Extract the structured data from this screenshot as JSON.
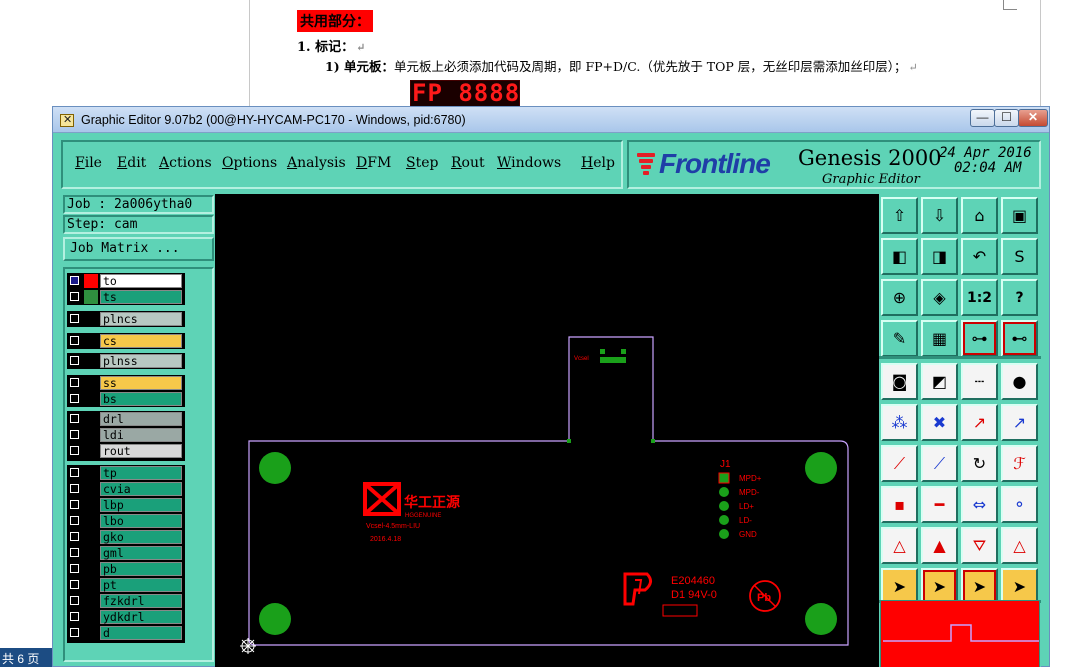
{
  "document": {
    "heading": "共用部分：",
    "section": "1.   标记：",
    "item_label": "1)   单元板：",
    "item_text": "单元板上必须添加代码及周期，即 FP+D/C.（优先放于 TOP 层，无丝印层需添加丝印层）；",
    "fp_sample": "FP 8888",
    "paragraph_mark": "↵",
    "status_page": "共 6 页"
  },
  "window": {
    "title": "Graphic Editor 9.07b2 (00@HY-HYCAM-PC170 - Windows, pid:6780)",
    "min": "—",
    "max": "☐",
    "close": "✕"
  },
  "menu": {
    "items": [
      "File",
      "Edit",
      "Actions",
      "Options",
      "Analysis",
      "DFM",
      "Step",
      "Rout",
      "Windows",
      "Help"
    ]
  },
  "brand": {
    "logo": "Frontline",
    "product": "Genesis 2000",
    "subtitle": "Graphic Editor",
    "date": "24 Apr 2016",
    "time": "02:04 AM",
    "accent": "#1f3ea7",
    "accent_red": "#e41e26"
  },
  "job": {
    "job_line": "Job : 2a006ytha0",
    "step_line": "Step: cam",
    "matrix_button": "Job Matrix ..."
  },
  "layers": [
    {
      "name": "to",
      "color": "#ff0000",
      "bg": "#ffffff",
      "checked": true
    },
    {
      "name": "ts",
      "color": "#2f8f3f",
      "bg": "#1aa07a",
      "checked": false
    },
    {
      "name": "plncs",
      "color": "#000000",
      "bg": "#b8c8c2",
      "checked": false
    },
    {
      "name": "cs",
      "color": "#000000",
      "bg": "#f6c84a",
      "checked": false
    },
    {
      "name": "plnss",
      "color": "#000000",
      "bg": "#b8c8c2",
      "checked": false
    },
    {
      "name": "ss",
      "color": "#000000",
      "bg": "#f6c84a",
      "checked": false
    },
    {
      "name": "bs",
      "color": "#000000",
      "bg": "#1aa07a",
      "checked": false
    },
    {
      "name": "drl",
      "color": "#000000",
      "bg": "#9aa8a4",
      "checked": false
    },
    {
      "name": "ldi",
      "color": "#000000",
      "bg": "#9aa8a4",
      "checked": false
    },
    {
      "name": "rout",
      "color": "#000000",
      "bg": "#d8d8d8",
      "checked": false
    },
    {
      "name": "tp",
      "color": "#000000",
      "bg": "#1aa07a",
      "checked": false
    },
    {
      "name": "cvia",
      "color": "#000000",
      "bg": "#1aa07a",
      "checked": false
    },
    {
      "name": "lbp",
      "color": "#000000",
      "bg": "#1aa07a",
      "checked": false
    },
    {
      "name": "lbo",
      "color": "#000000",
      "bg": "#1aa07a",
      "checked": false
    },
    {
      "name": "gko",
      "color": "#000000",
      "bg": "#1aa07a",
      "checked": false
    },
    {
      "name": "gml",
      "color": "#000000",
      "bg": "#1aa07a",
      "checked": false
    },
    {
      "name": "pb",
      "color": "#000000",
      "bg": "#1aa07a",
      "checked": false
    },
    {
      "name": "pt",
      "color": "#000000",
      "bg": "#1aa07a",
      "checked": false
    },
    {
      "name": "fzkdrl",
      "color": "#000000",
      "bg": "#1aa07a",
      "checked": false
    },
    {
      "name": "ydkdrl",
      "color": "#000000",
      "bg": "#1aa07a",
      "checked": false
    },
    {
      "name": "d",
      "color": "#000000",
      "bg": "#1aa07a",
      "checked": false
    }
  ],
  "board": {
    "vcsel_label": "Vcsel",
    "connector_label": "J1",
    "pins": [
      "MPD+",
      "MPD-",
      "LD+",
      "LD-",
      "GND"
    ],
    "company_cn": "华工正源",
    "company_en": "HGGENUINE",
    "part_text": "Vcsel-4.5mm-LIU",
    "date_text": "2016.4.18",
    "ul_code": "E204460",
    "ul_rating": "D1  94V-0",
    "pb_mark": "Pb",
    "outline_color": "#c9a3ff",
    "pad_color": "#1aa01a",
    "text_color": "#ff0000"
  },
  "toolbox": {
    "tools": [
      "zoom-home",
      "zoom-back",
      "home",
      "window-fit",
      "pan-left",
      "pan-right",
      "undo-redo",
      "snap",
      "fit-all",
      "center",
      "ratio-1-2",
      "help",
      "measure-tool",
      "grid",
      "route-tool-1",
      "route-tool-2",
      "select-feature",
      "draw-area",
      "ruler",
      "pad-select",
      "connect-nets",
      "cross-select",
      "arrow-red",
      "arrow-blue",
      "line-red",
      "line-blue",
      "rotate",
      "flip",
      "pad-add",
      "line-add",
      "mirror-x",
      "pad-group",
      "triangle-1",
      "triangle-2",
      "triangle-3",
      "triangle-4",
      "pointer",
      "pointer-box",
      "pointer-circle",
      "pointer-net"
    ],
    "ratio_label": "1:2",
    "help_label": "?"
  }
}
